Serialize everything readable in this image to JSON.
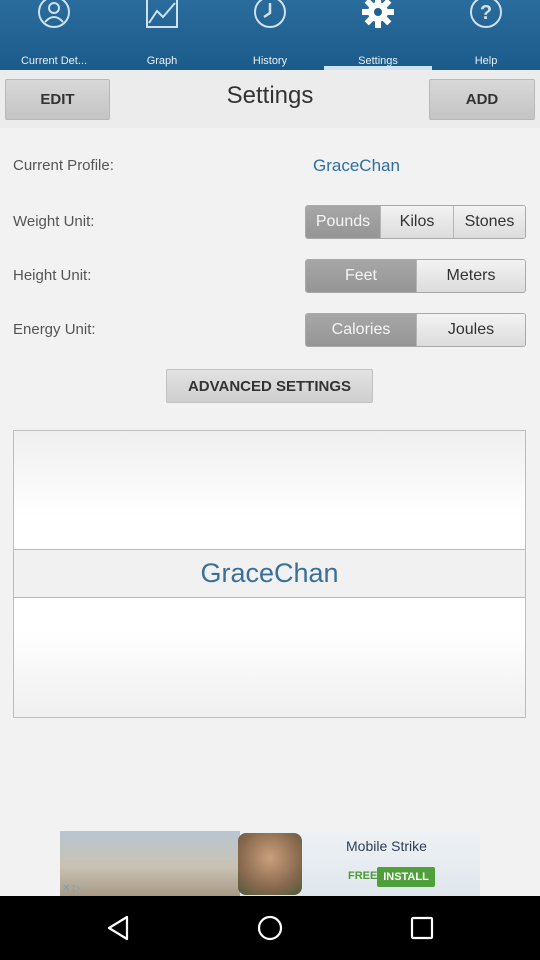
{
  "tabs": [
    {
      "label": "Current Det...",
      "icon": "person-icon",
      "active": false
    },
    {
      "label": "Graph",
      "icon": "graph-icon",
      "active": false
    },
    {
      "label": "History",
      "icon": "clock-icon",
      "active": false
    },
    {
      "label": "Settings",
      "icon": "gear-icon",
      "active": true
    },
    {
      "label": "Help",
      "icon": "help-icon",
      "active": false
    }
  ],
  "header": {
    "edit_label": "EDIT",
    "title": "Settings",
    "add_label": "ADD"
  },
  "profile": {
    "label": "Current Profile:",
    "value": "GraceChan"
  },
  "weight": {
    "label": "Weight Unit:",
    "options": [
      "Pounds",
      "Kilos",
      "Stones"
    ],
    "selected": "Pounds"
  },
  "height": {
    "label": "Height Unit:",
    "options": [
      "Feet",
      "Meters"
    ],
    "selected": "Feet"
  },
  "energy": {
    "label": "Energy Unit:",
    "options": [
      "Calories",
      "Joules"
    ],
    "selected": "Calories"
  },
  "advanced_label": "ADVANCED SETTINGS",
  "picker": {
    "selected_value": "GraceChan"
  },
  "ad": {
    "title": "Mobile Strike",
    "free_label": "FREE",
    "install_label": "INSTALL"
  },
  "colors": {
    "tabbar": "#1f5f90",
    "accent_text": "#2f6ea0",
    "selected_segment": "#9e9e9e"
  }
}
